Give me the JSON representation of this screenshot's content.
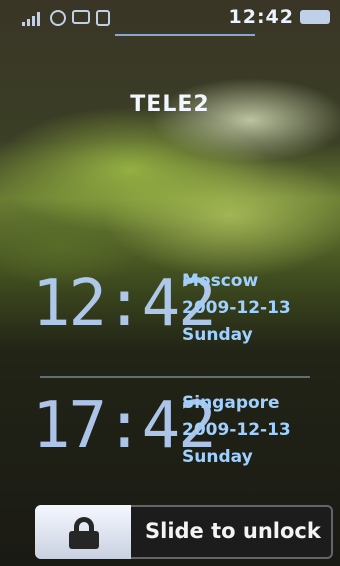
{
  "status_bar": {
    "time": "12:42",
    "icons": [
      "signal-icon",
      "alarm-icon",
      "message-icon",
      "sim-icon",
      "battery-icon"
    ]
  },
  "operator": "TELE2",
  "world_clocks": [
    {
      "time": "12:42",
      "city": "Moscow",
      "date": "2009-12-13",
      "day": "Sunday"
    },
    {
      "time": "17:42",
      "city": "Singapore",
      "date": "2009-12-13",
      "day": "Sunday"
    }
  ],
  "unlock": {
    "label": "Slide to unlock"
  }
}
